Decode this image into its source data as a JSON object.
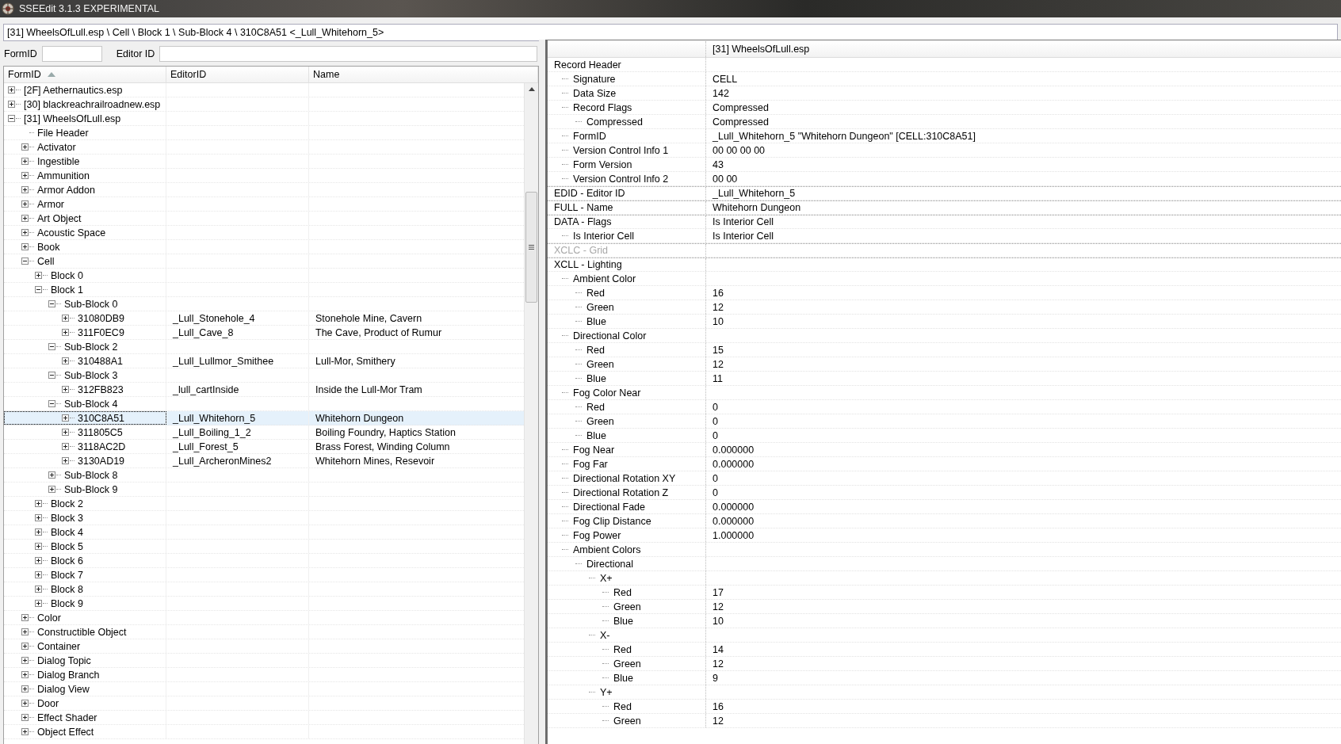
{
  "window": {
    "title": "SSEEdit 3.1.3 EXPERIMENTAL"
  },
  "path": "[31] WheelsOfLull.esp \\ Cell \\ Block 1 \\ Sub-Block 4 \\ 310C8A51 <_Lull_Whitehorn_5>",
  "filter": {
    "formid_label": "FormID",
    "editorid_label": "Editor ID"
  },
  "tree_columns": [
    {
      "label": "FormID",
      "sorted": true
    },
    {
      "label": "EditorID",
      "sorted": false
    },
    {
      "label": "Name",
      "sorted": false
    }
  ],
  "tree": [
    {
      "kind": "node",
      "label": "[2F] Aethernautics.esp",
      "expanded": false,
      "selected": false
    },
    {
      "kind": "node",
      "label": "[30] blackreachrailroadnew.esp",
      "expanded": false,
      "selected": false
    },
    {
      "kind": "node",
      "label": "[31] WheelsOfLull.esp",
      "expanded": true,
      "selected": false,
      "children": [
        {
          "kind": "leaf",
          "label": "File Header",
          "selected": false
        },
        {
          "kind": "node",
          "label": "Activator",
          "expanded": false,
          "selected": false
        },
        {
          "kind": "node",
          "label": "Ingestible",
          "expanded": false,
          "selected": false
        },
        {
          "kind": "node",
          "label": "Ammunition",
          "expanded": false,
          "selected": false
        },
        {
          "kind": "node",
          "label": "Armor Addon",
          "expanded": false,
          "selected": false
        },
        {
          "kind": "node",
          "label": "Armor",
          "expanded": false,
          "selected": false
        },
        {
          "kind": "node",
          "label": "Art Object",
          "expanded": false,
          "selected": false
        },
        {
          "kind": "node",
          "label": "Acoustic Space",
          "expanded": false,
          "selected": false
        },
        {
          "kind": "node",
          "label": "Book",
          "expanded": false,
          "selected": false
        },
        {
          "kind": "node",
          "label": "Cell",
          "expanded": true,
          "selected": false,
          "children": [
            {
              "kind": "node",
              "label": "Block 0",
              "expanded": false,
              "selected": false
            },
            {
              "kind": "node",
              "label": "Block 1",
              "expanded": true,
              "selected": false,
              "children": [
                {
                  "kind": "node",
                  "label": "Sub-Block 0",
                  "expanded": true,
                  "selected": false,
                  "children": [
                    {
                      "kind": "node",
                      "label": "31080DB9",
                      "editor_id": "_Lull_Stonehole_4",
                      "name": "Stonehole Mine, Cavern",
                      "expanded": false,
                      "selected": false
                    },
                    {
                      "kind": "node",
                      "label": "311F0EC9",
                      "editor_id": "_Lull_Cave_8",
                      "name": "The Cave, Product of Rumur",
                      "expanded": false,
                      "selected": false
                    }
                  ]
                },
                {
                  "kind": "node",
                  "label": "Sub-Block 2",
                  "expanded": true,
                  "selected": false,
                  "children": [
                    {
                      "kind": "node",
                      "label": "310488A1",
                      "editor_id": "_Lull_Lullmor_Smithee",
                      "name": "Lull-Mor, Smithery",
                      "expanded": false,
                      "selected": false
                    }
                  ]
                },
                {
                  "kind": "node",
                  "label": "Sub-Block 3",
                  "expanded": true,
                  "selected": false,
                  "children": [
                    {
                      "kind": "node",
                      "label": "312FB823",
                      "editor_id": "_lull_cartInside",
                      "name": "Inside the Lull-Mor Tram",
                      "expanded": false,
                      "selected": false
                    }
                  ]
                },
                {
                  "kind": "node",
                  "label": "Sub-Block 4",
                  "expanded": true,
                  "selected": false,
                  "children": [
                    {
                      "kind": "node",
                      "label": "310C8A51",
                      "editor_id": "_Lull_Whitehorn_5",
                      "name": "Whitehorn Dungeon",
                      "expanded": false,
                      "selected": true
                    },
                    {
                      "kind": "node",
                      "label": "311805C5",
                      "editor_id": "_Lull_Boiling_1_2",
                      "name": "Boiling Foundry, Haptics Station",
                      "expanded": false,
                      "selected": false
                    },
                    {
                      "kind": "node",
                      "label": "3118AC2D",
                      "editor_id": "_Lull_Forest_5",
                      "name": "Brass Forest, Winding Column",
                      "expanded": false,
                      "selected": false
                    },
                    {
                      "kind": "node",
                      "label": "3130AD19",
                      "editor_id": "_Lull_ArcheronMines2",
                      "name": "Whitehorn Mines, Resevoir",
                      "expanded": false,
                      "selected": false
                    }
                  ]
                },
                {
                  "kind": "node",
                  "label": "Sub-Block 8",
                  "expanded": false,
                  "selected": false
                },
                {
                  "kind": "node",
                  "label": "Sub-Block 9",
                  "expanded": false,
                  "selected": false
                }
              ]
            },
            {
              "kind": "node",
              "label": "Block 2",
              "expanded": false,
              "selected": false
            },
            {
              "kind": "node",
              "label": "Block 3",
              "expanded": false,
              "selected": false
            },
            {
              "kind": "node",
              "label": "Block 4",
              "expanded": false,
              "selected": false
            },
            {
              "kind": "node",
              "label": "Block 5",
              "expanded": false,
              "selected": false
            },
            {
              "kind": "node",
              "label": "Block 6",
              "expanded": false,
              "selected": false
            },
            {
              "kind": "node",
              "label": "Block 7",
              "expanded": false,
              "selected": false
            },
            {
              "kind": "node",
              "label": "Block 8",
              "expanded": false,
              "selected": false
            },
            {
              "kind": "node",
              "label": "Block 9",
              "expanded": false,
              "selected": false
            }
          ]
        },
        {
          "kind": "node",
          "label": "Color",
          "expanded": false,
          "selected": false
        },
        {
          "kind": "node",
          "label": "Constructible Object",
          "expanded": false,
          "selected": false
        },
        {
          "kind": "node",
          "label": "Container",
          "expanded": false,
          "selected": false
        },
        {
          "kind": "node",
          "label": "Dialog Topic",
          "expanded": false,
          "selected": false
        },
        {
          "kind": "node",
          "label": "Dialog Branch",
          "expanded": false,
          "selected": false
        },
        {
          "kind": "node",
          "label": "Dialog View",
          "expanded": false,
          "selected": false
        },
        {
          "kind": "node",
          "label": "Door",
          "expanded": false,
          "selected": false
        },
        {
          "kind": "node",
          "label": "Effect Shader",
          "expanded": false,
          "selected": false
        },
        {
          "kind": "node",
          "label": "Object Effect",
          "expanded": false,
          "selected": false
        }
      ]
    }
  ],
  "record": {
    "file_column": "[31] WheelsOfLull.esp",
    "fields": [
      {
        "label": "Record Header",
        "disabled": false,
        "children": [
          {
            "label": "Signature",
            "value": "CELL"
          },
          {
            "label": "Data Size",
            "value": "142"
          },
          {
            "label": "Record Flags",
            "value": "Compressed",
            "children": [
              {
                "label": "Compressed",
                "value": "Compressed"
              }
            ]
          },
          {
            "label": "FormID",
            "value": "_Lull_Whitehorn_5 \"Whitehorn Dungeon\" [CELL:310C8A51]"
          },
          {
            "label": "Version Control Info 1",
            "value": "00 00 00 00"
          },
          {
            "label": "Form Version",
            "value": "43"
          },
          {
            "label": "Version Control Info 2",
            "value": "00 00"
          }
        ]
      },
      {
        "label": "EDID - Editor ID",
        "value": "_Lull_Whitehorn_5",
        "disabled": false
      },
      {
        "label": "FULL - Name",
        "value": "Whitehorn Dungeon",
        "disabled": false
      },
      {
        "label": "DATA - Flags",
        "value": "Is Interior Cell",
        "disabled": false,
        "children": [
          {
            "label": "Is Interior Cell",
            "value": "Is Interior Cell"
          }
        ]
      },
      {
        "label": "XCLC - Grid",
        "disabled": true
      },
      {
        "label": "XCLL - Lighting",
        "disabled": false,
        "children": [
          {
            "label": "Ambient Color",
            "children": [
              {
                "label": "Red",
                "value": "16"
              },
              {
                "label": "Green",
                "value": "12"
              },
              {
                "label": "Blue",
                "value": "10"
              }
            ]
          },
          {
            "label": "Directional Color",
            "children": [
              {
                "label": "Red",
                "value": "15"
              },
              {
                "label": "Green",
                "value": "12"
              },
              {
                "label": "Blue",
                "value": "11"
              }
            ]
          },
          {
            "label": "Fog Color Near",
            "children": [
              {
                "label": "Red",
                "value": "0"
              },
              {
                "label": "Green",
                "value": "0"
              },
              {
                "label": "Blue",
                "value": "0"
              }
            ]
          },
          {
            "label": "Fog Near",
            "value": "0.000000"
          },
          {
            "label": "Fog Far",
            "value": "0.000000"
          },
          {
            "label": "Directional Rotation XY",
            "value": "0"
          },
          {
            "label": "Directional Rotation Z",
            "value": "0"
          },
          {
            "label": "Directional Fade",
            "value": "0.000000"
          },
          {
            "label": "Fog Clip Distance",
            "value": "0.000000"
          },
          {
            "label": "Fog Power",
            "value": "1.000000"
          },
          {
            "label": "Ambient Colors",
            "children": [
              {
                "label": "Directional",
                "children": [
                  {
                    "label": "X+",
                    "children": [
                      {
                        "label": "Red",
                        "value": "17"
                      },
                      {
                        "label": "Green",
                        "value": "12"
                      },
                      {
                        "label": "Blue",
                        "value": "10"
                      }
                    ]
                  },
                  {
                    "label": "X-",
                    "children": [
                      {
                        "label": "Red",
                        "value": "14"
                      },
                      {
                        "label": "Green",
                        "value": "12"
                      },
                      {
                        "label": "Blue",
                        "value": "9"
                      }
                    ]
                  },
                  {
                    "label": "Y+",
                    "children": [
                      {
                        "label": "Red",
                        "value": "16"
                      },
                      {
                        "label": "Green",
                        "value": "12"
                      }
                    ]
                  }
                ]
              }
            ]
          }
        ]
      }
    ]
  }
}
